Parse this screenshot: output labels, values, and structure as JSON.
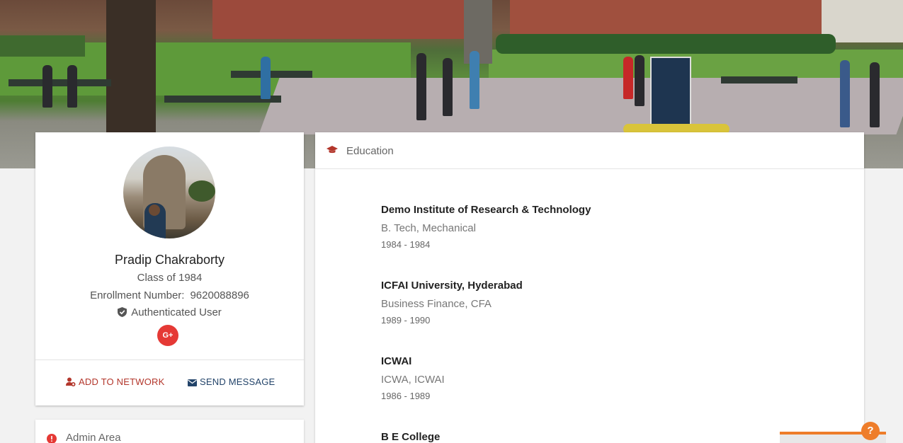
{
  "profile": {
    "name": "Pradip Chakraborty",
    "class_of": "Class of 1984",
    "enrollment_label": "Enrollment Number:",
    "enrollment_number": "9620088896",
    "authenticated": "Authenticated User",
    "social_icon_text": "G+",
    "actions": {
      "add_to_network": "ADD TO NETWORK",
      "send_message": "SEND MESSAGE"
    }
  },
  "admin": {
    "title": "Admin Area"
  },
  "education": {
    "title": "Education",
    "entries": [
      {
        "institution": "Demo Institute of Research & Technology",
        "degree": "B. Tech, Mechanical",
        "years": "1984 - 1984"
      },
      {
        "institution": "ICFAI University, Hyderabad",
        "degree": "Business Finance, CFA",
        "years": "1989 - 1990"
      },
      {
        "institution": "ICWAI",
        "degree": "ICWA, ICWAI",
        "years": "1986 - 1989"
      },
      {
        "institution": "B E College",
        "degree": "",
        "years": ""
      }
    ]
  },
  "help": {
    "button_text": "?"
  },
  "colors": {
    "accent_red": "#b3362b",
    "accent_blue": "#23446a",
    "gplus_red": "#e53935",
    "help_orange": "#ee7d2a"
  },
  "icons": {
    "education": "graduation-cap-icon",
    "admin": "info-icon",
    "authenticated": "shield-check-icon",
    "add_network": "add-user-icon",
    "send_message": "envelope-icon"
  }
}
